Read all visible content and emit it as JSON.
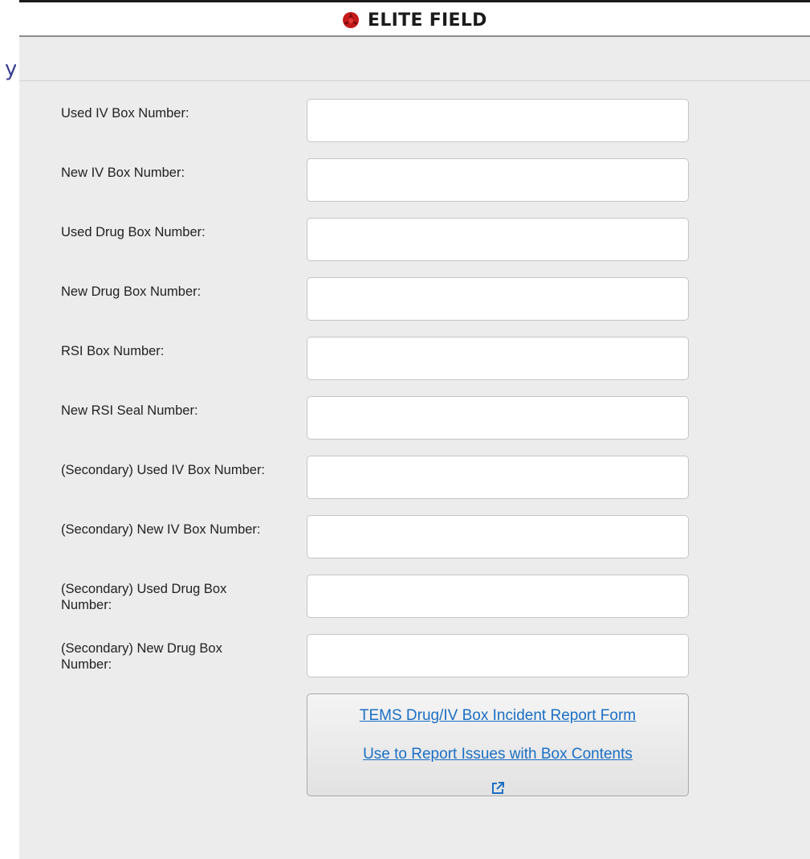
{
  "app": {
    "brand_name": "ELITE FIELD",
    "logo_color": "#c41a1a"
  },
  "form": {
    "fields": [
      {
        "label": "Used IV Box Number:",
        "value": ""
      },
      {
        "label": "New IV Box Number:",
        "value": ""
      },
      {
        "label": "Used Drug Box Number:",
        "value": ""
      },
      {
        "label": "New Drug Box Number:",
        "value": ""
      },
      {
        "label": "RSI Box Number:",
        "value": ""
      },
      {
        "label": "New RSI Seal Number:",
        "value": ""
      },
      {
        "label": "(Secondary) Used IV Box Number:",
        "value": ""
      },
      {
        "label": "(Secondary) New IV Box Number:",
        "value": ""
      },
      {
        "label": "(Secondary) Used Drug Box Number:",
        "value": ""
      },
      {
        "label": "(Secondary) New Drug Box Number:",
        "value": ""
      }
    ],
    "incident_link": {
      "line1": "TEMS Drug/IV Box Incident Report Form",
      "line2": "Use to Report Issues with Box Contents",
      "icon": "external-link-icon",
      "link_color": "#1a6fc4"
    }
  }
}
